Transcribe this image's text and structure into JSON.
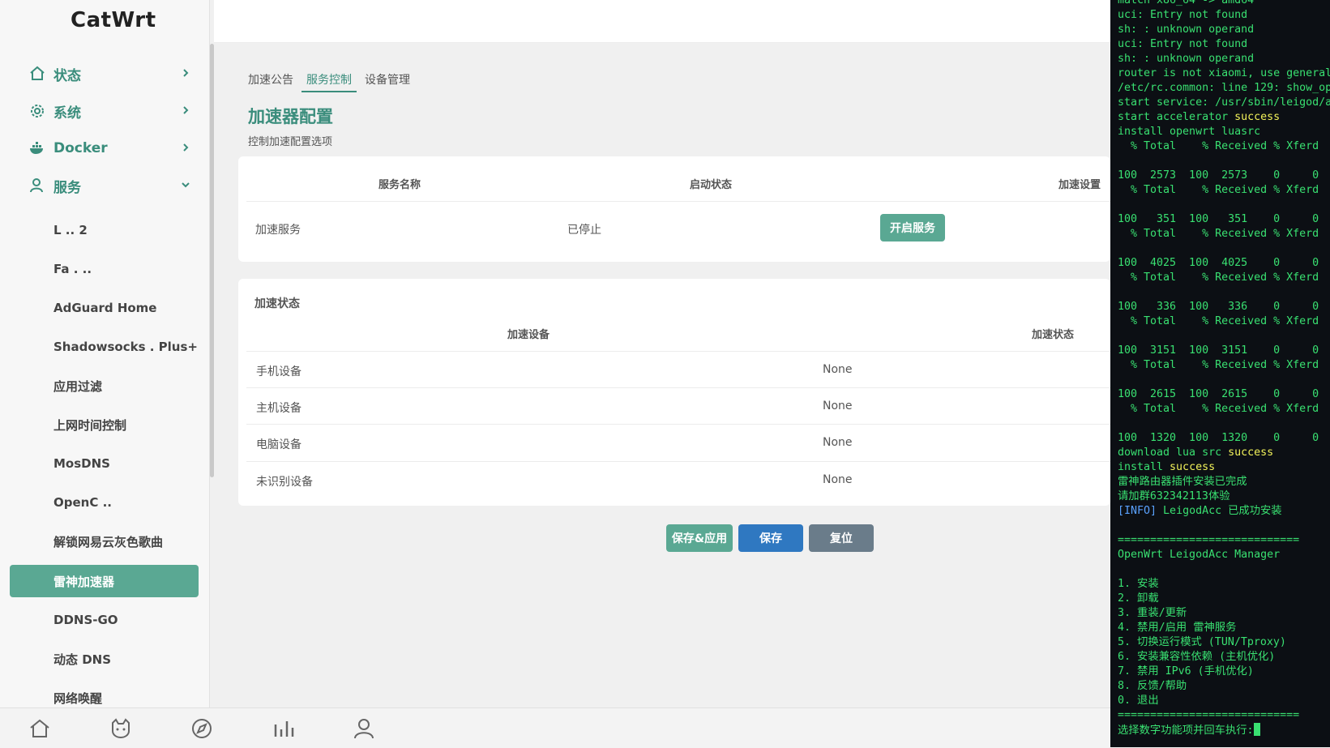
{
  "brand": "CatWrt",
  "colors": {
    "accent": "#3a8d7c",
    "accent_button": "#5aa893",
    "save_button": "#2f78c1",
    "reset_button": "#6a7c8a",
    "terminal_bg": "#0c0f14",
    "terminal_text": "#39e071",
    "terminal_highlight": "#f2f25a",
    "terminal_info": "#5aa2ff"
  },
  "sidebar": {
    "sections": [
      {
        "label": "状态",
        "icon": "home-icon"
      },
      {
        "label": "系统",
        "icon": "gear-icon"
      },
      {
        "label": "Docker",
        "icon": "docker-whale-icon"
      },
      {
        "label": "服务",
        "icon": "user-icon"
      }
    ],
    "sub_items": [
      "L        .. 2",
      "Fa   .  ..",
      "AdGuard Home",
      "Shadowsocks  . Plus+",
      "应用过滤",
      "上网时间控制",
      "MosDNS",
      "OpenC   ..",
      "解锁网易云灰色歌曲",
      "雷神加速器",
      "DDNS-GO",
      "动态 DNS",
      "网络唤醒"
    ],
    "active_sub_item": "雷神加速器"
  },
  "dock": {
    "icons": [
      "home-icon",
      "cat-icon",
      "compass-icon",
      "bar-chart-icon",
      "user-icon"
    ]
  },
  "tabs": [
    "加速公告",
    "服务控制",
    "设备管理"
  ],
  "active_tab": "服务控制",
  "page": {
    "title": "加速器配置",
    "description": "控制加速配置选项"
  },
  "service_table": {
    "headers": [
      "服务名称",
      "启动状态",
      "加速设置"
    ],
    "rows": [
      {
        "name": "加速服务",
        "status": "已停止",
        "action": "开启服务"
      }
    ]
  },
  "status_table": {
    "title": "加速状态",
    "headers": [
      "加速设备",
      "加速状态"
    ],
    "rows": [
      {
        "device": "手机设备",
        "value": "None"
      },
      {
        "device": "主机设备",
        "value": "None"
      },
      {
        "device": "电脑设备",
        "value": "None"
      },
      {
        "device": "未识别设备",
        "value": "None"
      }
    ]
  },
  "buttons": {
    "save_apply": "保存&应用",
    "save": "保存",
    "reset": "复位"
  },
  "terminal": {
    "lines": [
      "match x86_64 -> amd64",
      "uci: Entry not found",
      "sh: : unknown operand",
      "uci: Entry not found",
      "sh: : unknown operand",
      "router is not xiaomi, use general",
      "/etc/rc.common: line 129: show_op",
      "start service: /usr/sbin/leigod/a",
      "start accelerator |success",
      "install openwrt luasrc",
      "  % Total    % Received % Xferd",
      "",
      "100  2573  100  2573    0     0",
      "  % Total    % Received % Xferd",
      "",
      "100   351  100   351    0     0",
      "  % Total    % Received % Xferd",
      "",
      "100  4025  100  4025    0     0",
      "  % Total    % Received % Xferd",
      "",
      "100   336  100   336    0     0",
      "  % Total    % Received % Xferd",
      "",
      "100  3151  100  3151    0     0",
      "  % Total    % Received % Xferd",
      "",
      "100  2615  100  2615    0     0",
      "  % Total    % Received % Xferd",
      "",
      "100  1320  100  1320    0     0",
      "download lua src |success",
      "install |success",
      "雷神路由器插件安装已完成",
      "请加群632342113体验",
      "[INFO]| LeigodAcc 已成功安装",
      "",
      "============================",
      "OpenWrt LeigodAcc Manager",
      "",
      "1. 安装",
      "2. 卸载",
      "3. 重装/更新",
      "4. 禁用/启用 雷神服务",
      "5. 切换运行模式 (TUN/Tproxy)",
      "6. 安装兼容性依赖 (主机优化)",
      "7. 禁用 IPv6 (手机优化)",
      "8. 反馈/帮助",
      "0. 退出",
      "============================",
      "选择数字功能项并回车执行:"
    ]
  }
}
